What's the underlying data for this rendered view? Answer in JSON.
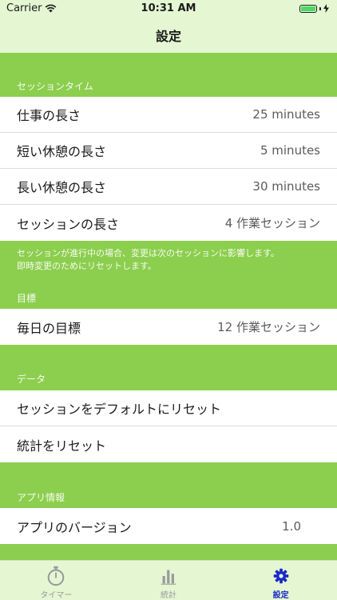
{
  "status_bar": {
    "carrier": "Carrier",
    "time": "10:31 AM"
  },
  "nav": {
    "title": "設定"
  },
  "sections": {
    "session_time": {
      "header": "セッションタイム",
      "rows": [
        {
          "label": "仕事の長さ",
          "value": "25 minutes"
        },
        {
          "label": "短い休憩の長さ",
          "value": "5 minutes"
        },
        {
          "label": "長い休憩の長さ",
          "value": "30 minutes"
        },
        {
          "label": "セッションの長さ",
          "value": "4 作業セッション"
        }
      ],
      "footer_line1": "セッションが進行中の場合、変更は次のセッションに影響します。",
      "footer_line2": "即時変更のためにリセットします。"
    },
    "goal": {
      "header": "目標",
      "rows": [
        {
          "label": "毎日の目標",
          "value": "12 作業セッション"
        }
      ]
    },
    "data": {
      "header": "データ",
      "rows": [
        {
          "label": "セッションをデフォルトにリセット"
        },
        {
          "label": "統計をリセット"
        }
      ]
    },
    "app_info": {
      "header": "アプリ情報",
      "rows": [
        {
          "label": "アプリのバージョン",
          "value": "1.0"
        }
      ]
    }
  },
  "tab_bar": {
    "tabs": [
      {
        "label": "タイマー",
        "icon": "stopwatch-icon"
      },
      {
        "label": "統計",
        "icon": "bar-chart-icon"
      },
      {
        "label": "設定",
        "icon": "gear-icon"
      }
    ],
    "active_index": 2
  },
  "colors": {
    "background": "#8cce4e",
    "bars": "#e4f6d2",
    "active_tab": "#1a28c9",
    "inactive_tab": "#9a9a9a"
  }
}
